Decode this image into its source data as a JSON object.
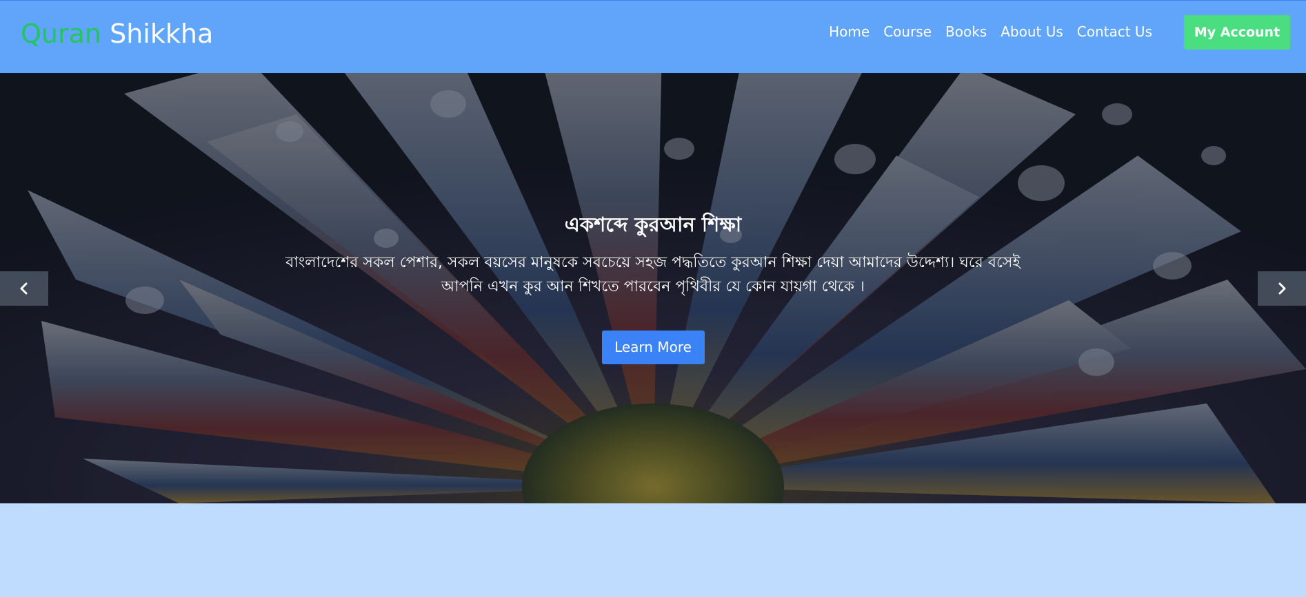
{
  "brand": {
    "part1": "Quran",
    "part2": "Shikkha"
  },
  "nav": {
    "links": [
      "Home",
      "Course",
      "Books",
      "About Us",
      "Contact Us"
    ],
    "account_label": "My Account"
  },
  "hero": {
    "title": "একশব্দে কুরআন শিক্ষা",
    "text": "বাংলাদেশের সকল পেশার, সকল বয়সের মানুষকে সবচেয়ে সহজ পদ্ধতিতে কুরআন শিক্ষা দেয়া আমাদের উদ্দেশ্য। ঘরে বসেই আপনি এখন কুর আন শিখতে পারবেন পৃথিবীর যে কোন যায়গা থেকে ।",
    "button_label": "Learn More",
    "prev_icon": "chevron-left-icon",
    "next_icon": "chevron-right-icon"
  },
  "colors": {
    "navbar_bg": "#60a5fa",
    "brand_accent": "#22c55e",
    "account_btn": "#4ade80",
    "learn_btn": "#3b82f6",
    "page_bg": "#bfdbfe"
  }
}
